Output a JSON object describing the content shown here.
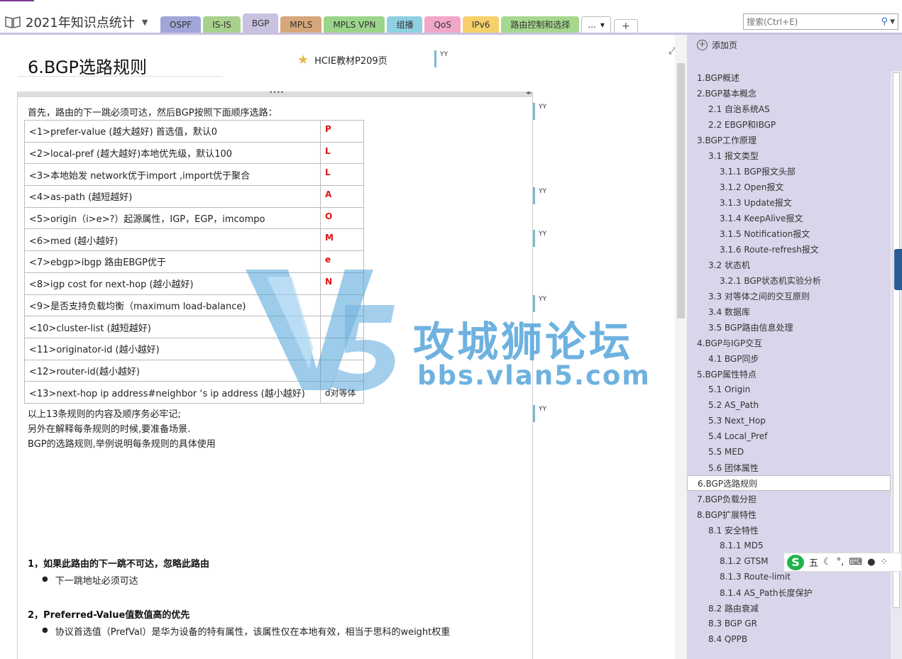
{
  "notebook": {
    "title": "2021年知识点统计"
  },
  "tabs": [
    {
      "label": "OSPF",
      "color": "#9ea7d8"
    },
    {
      "label": "IS-IS",
      "color": "#a8d18d"
    },
    {
      "label": "BGP",
      "color": "#c8c2e0",
      "active": true
    },
    {
      "label": "MPLS",
      "color": "#d6a77a"
    },
    {
      "label": "MPLS VPN",
      "color": "#9bd58a"
    },
    {
      "label": "组播",
      "color": "#8fd0e2"
    },
    {
      "label": "QoS",
      "color": "#f2a7c8"
    },
    {
      "label": "IPv6",
      "color": "#f6d06a"
    },
    {
      "label": "路由控制和选择",
      "color": "#a7d88f"
    }
  ],
  "tab_more": {
    "label": "...",
    "chevron": "▾"
  },
  "search": {
    "placeholder": "搜索(Ctrl+E)"
  },
  "page": {
    "title": "6.BGP选路规则",
    "reference": "HCIE教材P209页",
    "intro": "首先，路由的下一跳必须可达，然后BGP按照下面顺序选路：",
    "rules": [
      {
        "rule": "<1>prefer-value (越大越好) 首选值，默认0",
        "code": "P"
      },
      {
        "rule": "<2>local-pref (越大越好)本地优先级，默认100",
        "code": "L"
      },
      {
        "rule": "<3>本地始发 network优于import ,import优于聚合",
        "code": "L"
      },
      {
        "rule": "<4>as-path (越短越好)",
        "code": "A"
      },
      {
        "rule": "<5>origin（i>e>?）起源属性，IGP，EGP，imcompo",
        "code": "O"
      },
      {
        "rule": "<6>med (越小越好)",
        "code": "M"
      },
      {
        "rule": "<7>ebgp>ibgp 路由EBGP优于",
        "code": "e"
      },
      {
        "rule": "<8>igp cost for next-hop (越小越好)",
        "code": "N"
      },
      {
        "rule": "<9>是否支持负载均衡（maximum load-balance)",
        "code": ""
      },
      {
        "rule": "<10>cluster-list (越短越好)",
        "code": ""
      },
      {
        "rule": "<11>originator-id (越小越好)",
        "code": ""
      },
      {
        "rule": "<12>router-id(越小越好)",
        "code": ""
      },
      {
        "rule": "<13>next-hop ip address#neighbor ‘s ip address (越小越好)",
        "code": "d对等体"
      }
    ],
    "after": [
      "以上13条规则的内容及顺序务必牢记;",
      "另外在解释每条规则的时候,要准备场景.",
      "BGP的选路规则,举例说明每条规则的具体使用"
    ],
    "sections": [
      {
        "heading": "1，如果此路由的下一跳不可达，忽略此路由",
        "bullet": "下一跳地址必须可达"
      },
      {
        "heading": "2，Preferred-Value值数值高的优先",
        "bullet": "协议首选值（PrefVal）是华为设备的特有属性，该属性仅在本地有效，相当于思科的weight权重"
      }
    ],
    "author_tag": "YY"
  },
  "watermark": {
    "title": "攻城狮论坛",
    "url": "bbs.vlan5.com"
  },
  "panel": {
    "add_page": "添加页",
    "pages": [
      {
        "label": "1.BGP概述",
        "level": 0
      },
      {
        "label": "2.BGP基本概念",
        "level": 0
      },
      {
        "label": "2.1 自治系统AS",
        "level": 1
      },
      {
        "label": "2.2 EBGP和IBGP",
        "level": 1
      },
      {
        "label": "3.BGP工作原理",
        "level": 0
      },
      {
        "label": "3.1 报文类型",
        "level": 1
      },
      {
        "label": "3.1.1 BGP报文头部",
        "level": 2
      },
      {
        "label": "3.1.2 Open报文",
        "level": 2
      },
      {
        "label": "3.1.3 Update报文",
        "level": 2
      },
      {
        "label": "3.1.4 KeepAlive报文",
        "level": 2
      },
      {
        "label": "3.1.5 Notification报文",
        "level": 2
      },
      {
        "label": "3.1.6 Route-refresh报文",
        "level": 2
      },
      {
        "label": "3.2 状态机",
        "level": 1
      },
      {
        "label": "3.2.1 BGP状态机实验分析",
        "level": 2
      },
      {
        "label": "3.3 对等体之间的交互原则",
        "level": 1
      },
      {
        "label": "3.4 数据库",
        "level": 1
      },
      {
        "label": "3.5 BGP路由信息处理",
        "level": 1
      },
      {
        "label": "4.BGP与IGP交互",
        "level": 0
      },
      {
        "label": "4.1 BGP同步",
        "level": 1
      },
      {
        "label": "5.BGP属性特点",
        "level": 0
      },
      {
        "label": "5.1 Origin",
        "level": 1
      },
      {
        "label": "5.2 AS_Path",
        "level": 1
      },
      {
        "label": "5.3 Next_Hop",
        "level": 1
      },
      {
        "label": "5.4 Local_Pref",
        "level": 1
      },
      {
        "label": "5.5 MED",
        "level": 1
      },
      {
        "label": "5.6 团体属性",
        "level": 1
      },
      {
        "label": "6.BGP选路规则",
        "level": 0,
        "selected": true
      },
      {
        "label": "7.BGP负载分担",
        "level": 0
      },
      {
        "label": "8.BGP扩展特性",
        "level": 0
      },
      {
        "label": "8.1 安全特性",
        "level": 1
      },
      {
        "label": "8.1.1 MD5",
        "level": 2
      },
      {
        "label": "8.1.2 GTSM",
        "level": 2
      },
      {
        "label": "8.1.3 Route-limit",
        "level": 2
      },
      {
        "label": "8.1.4 AS_Path长度保护",
        "level": 2
      },
      {
        "label": "8.2 路由衰减",
        "level": 1
      },
      {
        "label": "8.3 BGP GR",
        "level": 1
      },
      {
        "label": "8.4 QPPB",
        "level": 1
      }
    ]
  },
  "ime": {
    "logo": "S",
    "mode": "五"
  }
}
